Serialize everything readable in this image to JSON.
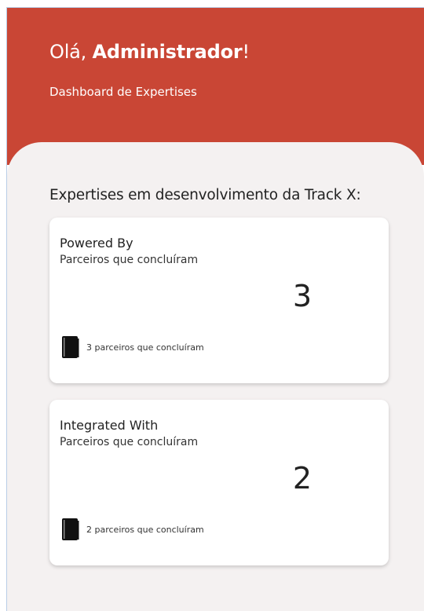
{
  "header": {
    "greeting_prefix": "Olá, ",
    "user_name": "Administrador",
    "greeting_suffix": "!",
    "subtitle": "Dashboard de Expertises",
    "color": "#c94635"
  },
  "main": {
    "section_title": "Expertises em desenvolvimento da Track X:",
    "cards": [
      {
        "title": "Powered By",
        "subtitle": "Parceiros que concluíram",
        "value": "3",
        "footer_icon": "book-icon",
        "footer_text": "3 parceiros que concluíram"
      },
      {
        "title": "Integrated With",
        "subtitle": "Parceiros que concluíram",
        "value": "2",
        "footer_icon": "book-icon",
        "footer_text": "2 parceiros que concluíram"
      }
    ]
  }
}
